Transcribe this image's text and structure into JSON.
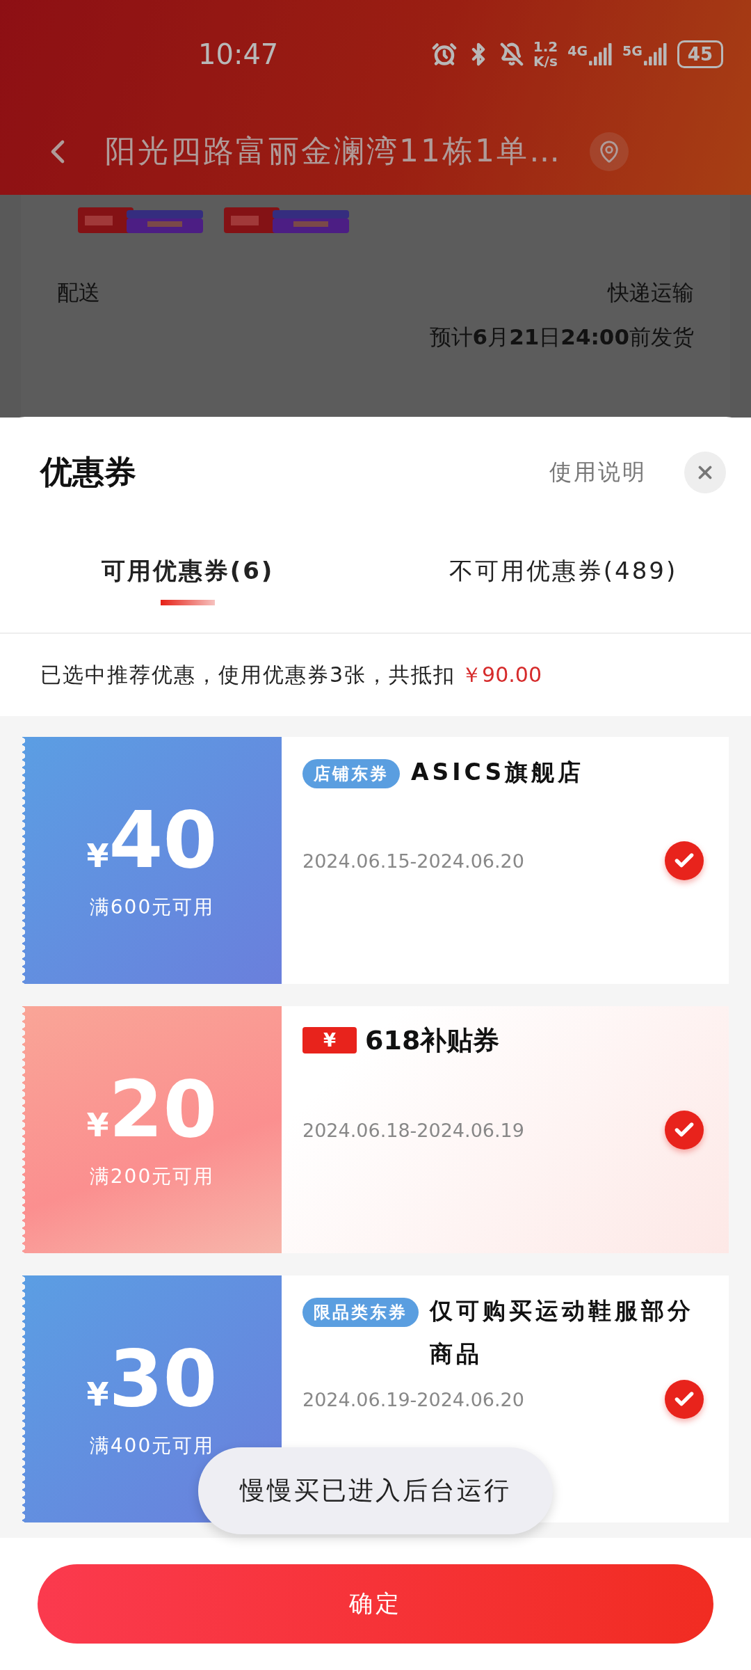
{
  "status_bar": {
    "time": "10:47",
    "speed_value": "1.2",
    "speed_unit": "K/s",
    "networks": [
      {
        "label": "4G"
      },
      {
        "label": "5G"
      }
    ],
    "battery": "45"
  },
  "header": {
    "title": "阳光四路富丽金澜湾11栋1单…"
  },
  "order": {
    "delivery_label": "配送",
    "delivery_method": "快递运输",
    "delivery_estimate": "预计**6**月**21**日**24:00**前发货"
  },
  "sheet": {
    "title": "优惠券",
    "help_link": "使用说明",
    "tabs": [
      {
        "label": "可用优惠券(6)",
        "selected": true
      },
      {
        "label": "不可用优惠券(489)",
        "selected": false
      }
    ],
    "summary": {
      "text": "已选中推荐优惠，使用优惠券3张，共抵扣",
      "amount": "￥90.00"
    },
    "coupons": [
      {
        "kind": "tagged",
        "currency": "¥",
        "amount": "40",
        "condition": "满600元可用",
        "tag": "店铺东券",
        "title": "ASICS旗舰店",
        "validity": "2024.06.15-2024.06.20",
        "checked": true
      },
      {
        "kind": "badge",
        "currency": "¥",
        "amount": "20",
        "condition": "满200元可用",
        "badge": "¥",
        "title": "618补贴券",
        "validity": "2024.06.18-2024.06.19",
        "checked": true
      },
      {
        "kind": "tagged",
        "currency": "¥",
        "amount": "30",
        "condition": "满400元可用",
        "tag": "限品类东券",
        "title": "仅可购买运动鞋服部分商品",
        "validity": "2024.06.19-2024.06.20",
        "checked": true
      }
    ],
    "confirm_button": "确定"
  },
  "toast": "慢慢买已进入后台运行"
}
